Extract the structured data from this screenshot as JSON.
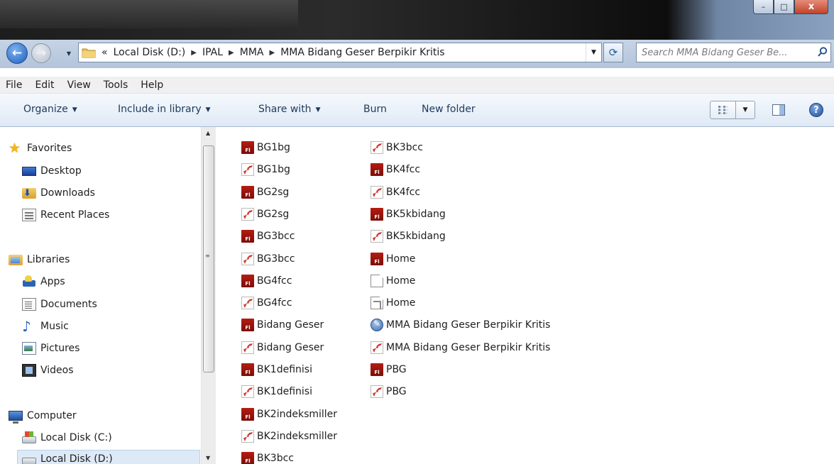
{
  "window": {
    "controls": {
      "minimize": "–",
      "maximize": "□",
      "close": "x"
    }
  },
  "address": {
    "overflow": "«",
    "breadcrumbs": [
      "Local Disk (D:)",
      "IPAL",
      "MMA",
      "MMA Bidang Geser Berpikir Kritis"
    ],
    "search_placeholder": "Search MMA Bidang Geser Be..."
  },
  "menu": [
    "File",
    "Edit",
    "View",
    "Tools",
    "Help"
  ],
  "commands": {
    "organize": "Organize",
    "include": "Include in library",
    "share": "Share with",
    "burn": "Burn",
    "new_folder": "New folder"
  },
  "nav": {
    "favorites": "Favorites",
    "desktop": "Desktop",
    "downloads": "Downloads",
    "recent": "Recent Places",
    "libraries": "Libraries",
    "apps": "Apps",
    "documents": "Documents",
    "music": "Music",
    "pictures": "Pictures",
    "videos": "Videos",
    "computer": "Computer",
    "disk_c": "Local Disk (C:)",
    "disk_d": "Local Disk (D:)"
  },
  "files_col1": [
    {
      "name": "BG1bg",
      "type": "fla"
    },
    {
      "name": "BG1bg",
      "type": "swf"
    },
    {
      "name": "BG2sg",
      "type": "fla"
    },
    {
      "name": "BG2sg",
      "type": "swf"
    },
    {
      "name": "BG3bcc",
      "type": "fla"
    },
    {
      "name": "BG3bcc",
      "type": "swf"
    },
    {
      "name": "BG4fcc",
      "type": "fla"
    },
    {
      "name": "BG4fcc",
      "type": "swf"
    },
    {
      "name": "Bidang Geser",
      "type": "fla"
    },
    {
      "name": "Bidang Geser",
      "type": "swf"
    },
    {
      "name": "BK1definisi",
      "type": "fla"
    },
    {
      "name": "BK1definisi",
      "type": "swf"
    },
    {
      "name": "BK2indeksmiller",
      "type": "fla"
    },
    {
      "name": "BK2indeksmiller",
      "type": "swf"
    },
    {
      "name": "BK3bcc",
      "type": "fla"
    }
  ],
  "files_col2": [
    {
      "name": "BK3bcc",
      "type": "swf"
    },
    {
      "name": "BK4fcc",
      "type": "fla"
    },
    {
      "name": "BK4fcc",
      "type": "swf"
    },
    {
      "name": "BK5kbidang",
      "type": "fla"
    },
    {
      "name": "BK5kbidang",
      "type": "swf"
    },
    {
      "name": "Home",
      "type": "fla"
    },
    {
      "name": "Home",
      "type": "doc"
    },
    {
      "name": "Home",
      "type": "lnk"
    },
    {
      "name": "MMA Bidang Geser Berpikir Kritis",
      "type": "html"
    },
    {
      "name": "MMA Bidang Geser Berpikir Kritis",
      "type": "swf"
    },
    {
      "name": "PBG",
      "type": "fla"
    },
    {
      "name": "PBG",
      "type": "swf"
    }
  ]
}
